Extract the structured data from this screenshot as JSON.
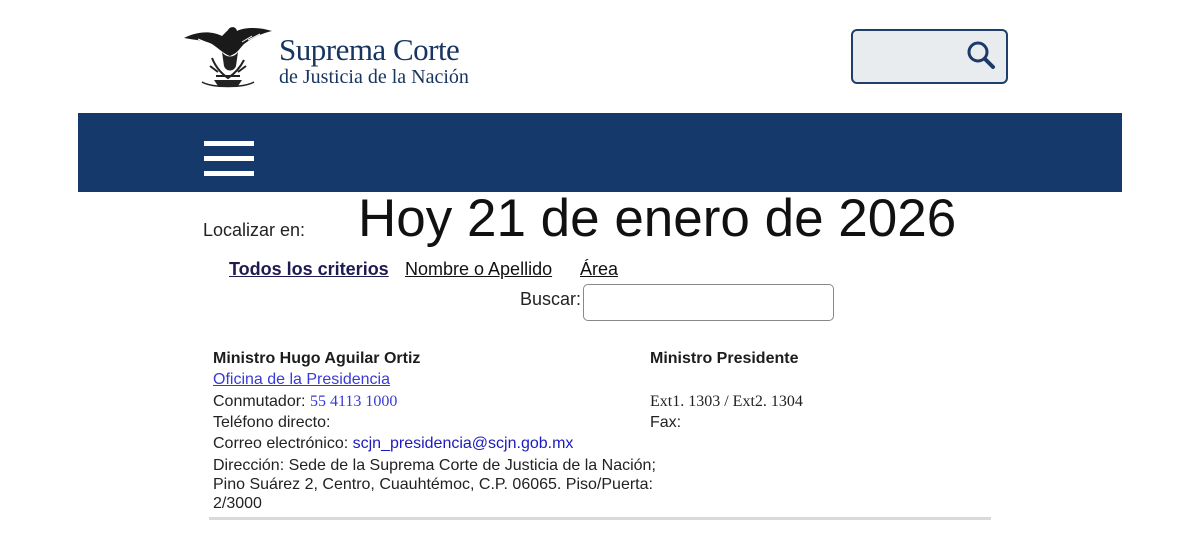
{
  "header": {
    "logo_title": "Suprema Corte",
    "logo_subtitle": "de Justicia de la Nación",
    "search_icon": "search-icon"
  },
  "nav": {
    "menu_icon": "hamburger-menu-icon",
    "bar_color": "#16396c"
  },
  "main": {
    "locate_label": "Localizar en:",
    "date_heading": "Hoy 21 de enero de 2026",
    "criteria": [
      {
        "label": "Todos los criterios",
        "active": true
      },
      {
        "label": "Nombre o Apellido",
        "active": false
      },
      {
        "label": "Área",
        "active": false
      }
    ],
    "buscar_label": "Buscar:",
    "buscar_value": ""
  },
  "entry": {
    "name": "Ministro Hugo Aguilar Ortiz",
    "office": "Oficina de la Presidencia",
    "conmutador_label": "Conmutador:",
    "conmutador_value": "55 4113 1000",
    "telefono_label": "Teléfono directo:",
    "correo_label": "Correo electrónico:",
    "correo_value": "scjn_presidencia@scjn.gob.mx",
    "direccion_1": "Dirección: Sede de la Suprema Corte de Justicia de la Nación;",
    "direccion_2": "Pino Suárez 2, Centro, Cuauhtémoc, C.P. 06065. Piso/Puerta:",
    "direccion_3": "2/3000",
    "position": "Ministro Presidente",
    "extensions": "Ext1. 1303 / Ext2. 1304",
    "fax_label": "Fax:"
  }
}
